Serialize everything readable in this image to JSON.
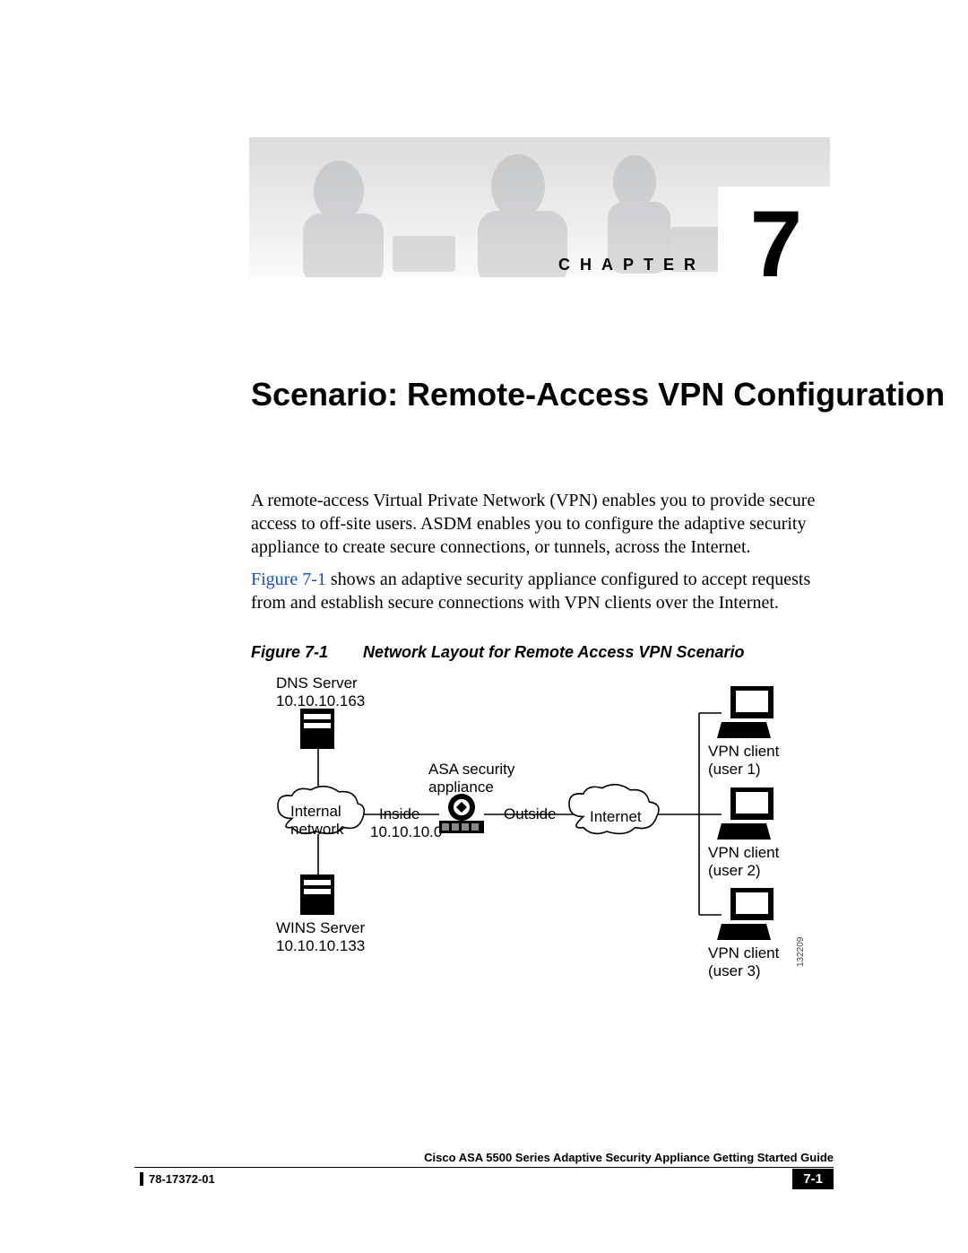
{
  "banner": {
    "chapter_word": "CHAPTER",
    "chapter_number": "7"
  },
  "title": "Scenario: Remote-Access VPN Configuration",
  "paragraphs": {
    "p1": "A remote-access Virtual Private Network (VPN) enables you to provide secure access to off-site users. ASDM enables you to configure the adaptive security appliance to create secure connections, or tunnels, across the Internet.",
    "p2_ref": "Figure 7-1",
    "p2_rest": " shows an adaptive security appliance configured to accept requests from and establish secure connections with VPN clients over the Internet."
  },
  "figure": {
    "number": "Figure 7-1",
    "title": "Network Layout for Remote Access VPN Scenario"
  },
  "diagram": {
    "dns_label": "DNS Server",
    "dns_ip": "10.10.10.163",
    "wins_label": "WINS Server",
    "wins_ip": "10.10.10.133",
    "asa_label_1": "ASA security",
    "asa_label_2": "appliance",
    "internal_1": "Internal",
    "internal_2": "network",
    "inside": "Inside",
    "inside_ip": "10.10.10.0",
    "outside": "Outside",
    "internet": "Internet",
    "vpn1_1": "VPN client",
    "vpn1_2": "(user 1)",
    "vpn2_1": "VPN client",
    "vpn2_2": "(user 2)",
    "vpn3_1": "VPN client",
    "vpn3_2": "(user 3)",
    "id": "132209"
  },
  "footer": {
    "guide_title": "Cisco ASA 5500 Series Adaptive Security Appliance Getting Started Guide",
    "doc_number": "78-17372-01",
    "page_number": "7-1"
  }
}
